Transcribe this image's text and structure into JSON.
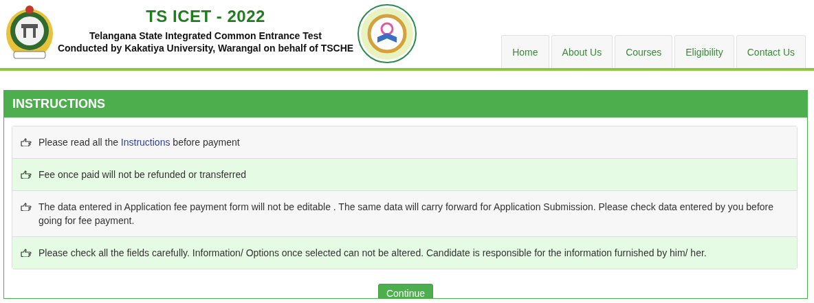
{
  "header": {
    "title": "TS ICET - 2022",
    "subtitle": "Telangana State Integrated Common Entrance Test",
    "byline": "Conducted by Kakatiya University, Warangal on behalf of TSCHE"
  },
  "nav": [
    {
      "label": "Home"
    },
    {
      "label": "About Us"
    },
    {
      "label": "Courses"
    },
    {
      "label": "Eligibility"
    },
    {
      "label": "Contact Us"
    }
  ],
  "panel": {
    "title": "INSTRUCTIONS",
    "items": [
      {
        "parts": [
          {
            "text": "Please read all the "
          },
          {
            "text": "Instructions",
            "link": true
          },
          {
            "text": " before payment"
          }
        ]
      },
      {
        "parts": [
          {
            "text": "Fee once paid will not be refunded or transferred"
          }
        ]
      },
      {
        "parts": [
          {
            "text": "The data entered in Application fee payment form will not be editable . The same data will carry forward for Application Submission. Please check data entered by you before going for fee payment."
          }
        ]
      },
      {
        "parts": [
          {
            "text": "Please check all the fields carefully. Information/ Options once selected can not be altered. Candidate is responsible for the information furnished by him/ her."
          }
        ]
      }
    ],
    "button": "Continue"
  }
}
